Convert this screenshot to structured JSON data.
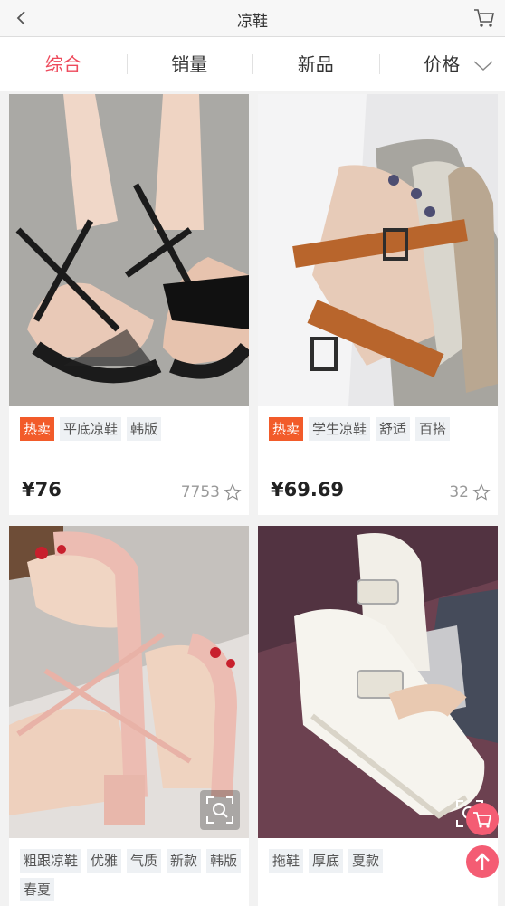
{
  "header": {
    "title": "凉鞋",
    "back_icon": "back-chevron-icon",
    "cart_icon": "cart-icon"
  },
  "tabs": [
    {
      "label": "综合",
      "active": true
    },
    {
      "label": "销量",
      "active": false
    },
    {
      "label": "新品",
      "active": false
    },
    {
      "label": "价格",
      "active": false
    }
  ],
  "products": [
    {
      "tags": [
        "热卖",
        "平底凉鞋",
        "韩版"
      ],
      "hot": true,
      "price": "¥76",
      "count": "7753"
    },
    {
      "tags": [
        "热卖",
        "学生凉鞋",
        "舒适",
        "百搭"
      ],
      "hot": true,
      "price": "¥69.69",
      "count": "32"
    },
    {
      "tags": [
        "粗跟凉鞋",
        "优雅",
        "气质",
        "新款",
        "韩版",
        "春夏"
      ],
      "hot": false
    },
    {
      "tags": [
        "拖鞋",
        "厚底",
        "夏款"
      ],
      "hot": false
    }
  ],
  "colors": {
    "accent": "#ee4a5c",
    "hot_tag": "#f25b2a",
    "fab": "#f45c73"
  }
}
